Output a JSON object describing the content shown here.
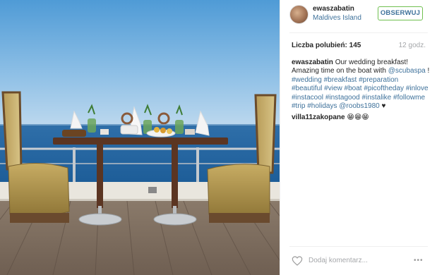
{
  "header": {
    "username": "ewaszabatin",
    "location": "Maldives Island",
    "follow_label": "OBSERWUJ"
  },
  "stats": {
    "likes_label": "Liczba polubień: 145",
    "time": "12 godz."
  },
  "caption": {
    "username": "ewaszabatin",
    "text_1": " Our wedding breakfast! Amazing time on the boat with ",
    "mention": "@scubaspa",
    "text_2": " !",
    "tags": [
      "#wedding",
      "#breakfast",
      "#preparation",
      "#beautiful",
      "#view",
      "#boat",
      "#picoftheday",
      "#inlove",
      "#instacool",
      "#instagood",
      "#instalike",
      "#followme",
      "#trip",
      "#holidays",
      "@roobs1980"
    ],
    "trailing": " ♥"
  },
  "comments": [
    {
      "username": "villa11zakopane",
      "text": " 😁😁😁"
    }
  ],
  "footer": {
    "add_comment_placeholder": "Dodaj komentarz...",
    "more_label": "•••"
  },
  "icons": {
    "avatar": "avatar",
    "like": "heart-icon",
    "more": "more-options-icon"
  },
  "colors": {
    "link": "#3f729b",
    "follow_border": "#70c050",
    "muted": "#a5a7aa"
  }
}
